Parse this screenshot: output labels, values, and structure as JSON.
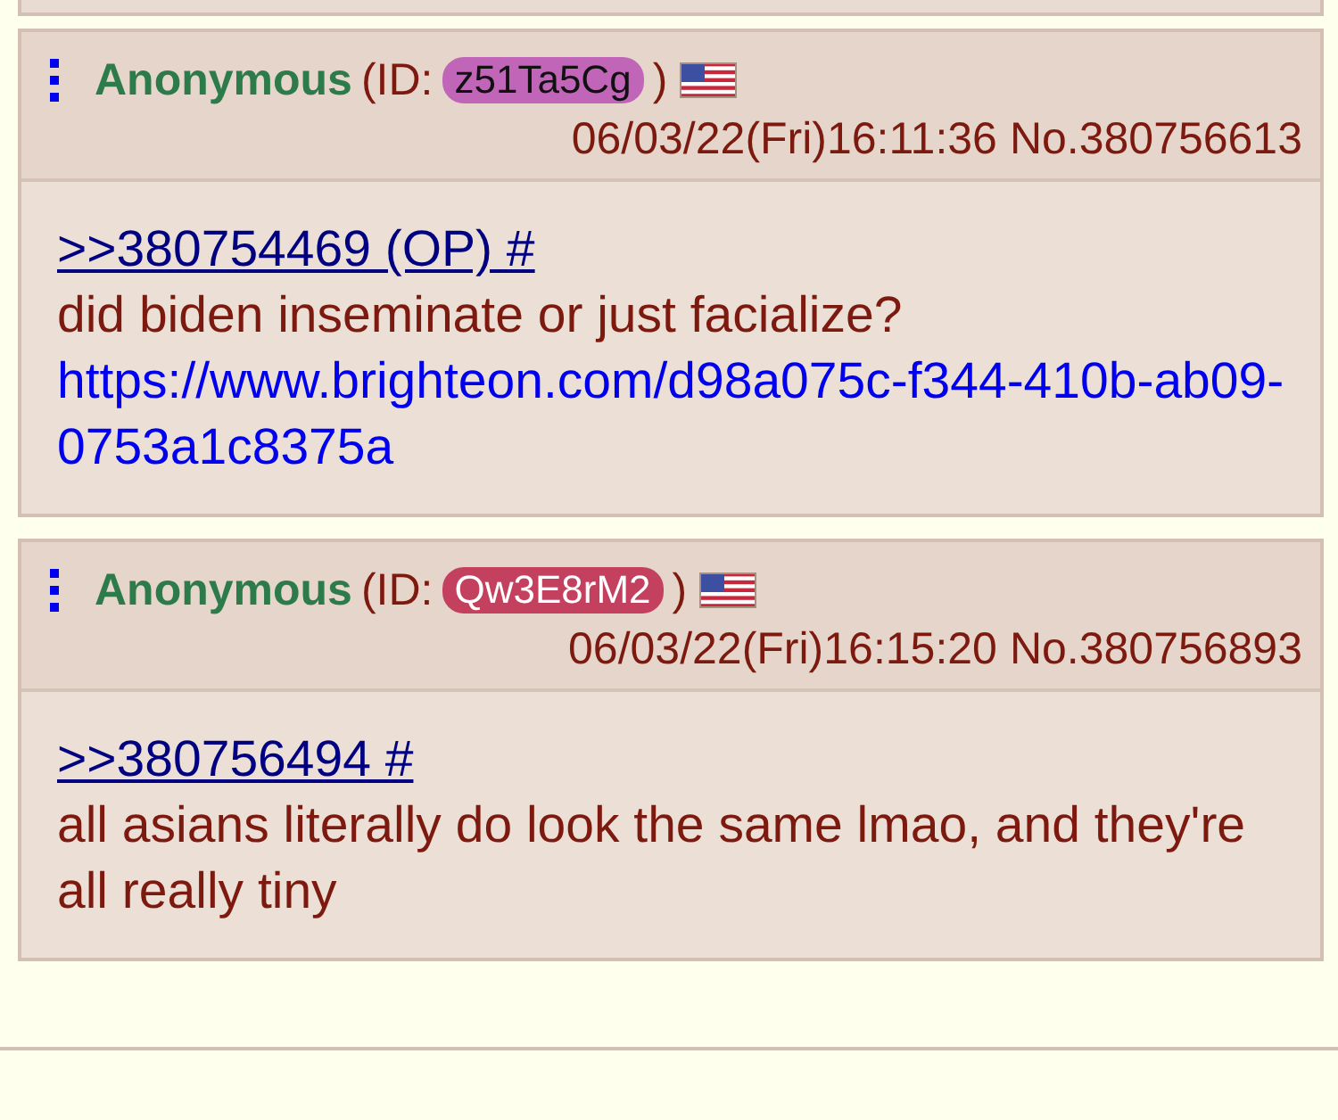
{
  "posts": [
    {
      "name": "Anonymous",
      "id_prefix": "(ID:",
      "id": "z51Ta5Cg",
      "color": "#c065b8",
      "id_suffix": ")",
      "date": "06/03/22(Fri)16:11:36",
      "number": "No.380756613",
      "lines": [
        {
          "kind": "quote",
          "text": ">>380754469 (OP) #"
        },
        {
          "kind": "text",
          "text": "did biden inseminate or just facialize?"
        },
        {
          "kind": "url",
          "text": "https://www.brighteon.com/d98a075c-f344-410b-ab09-0753a1c8375a"
        }
      ]
    },
    {
      "name": "Anonymous",
      "id_prefix": "(ID:",
      "id": "Qw3E8rM2",
      "color": "#c4405f",
      "id_suffix": ")",
      "date": "06/03/22(Fri)16:15:20",
      "number": "No.380756893",
      "lines": [
        {
          "kind": "quote",
          "text": ">>380756494 #"
        },
        {
          "kind": "text",
          "text": "all asians literally do look the same lmao, and they're all really tiny"
        }
      ]
    }
  ]
}
